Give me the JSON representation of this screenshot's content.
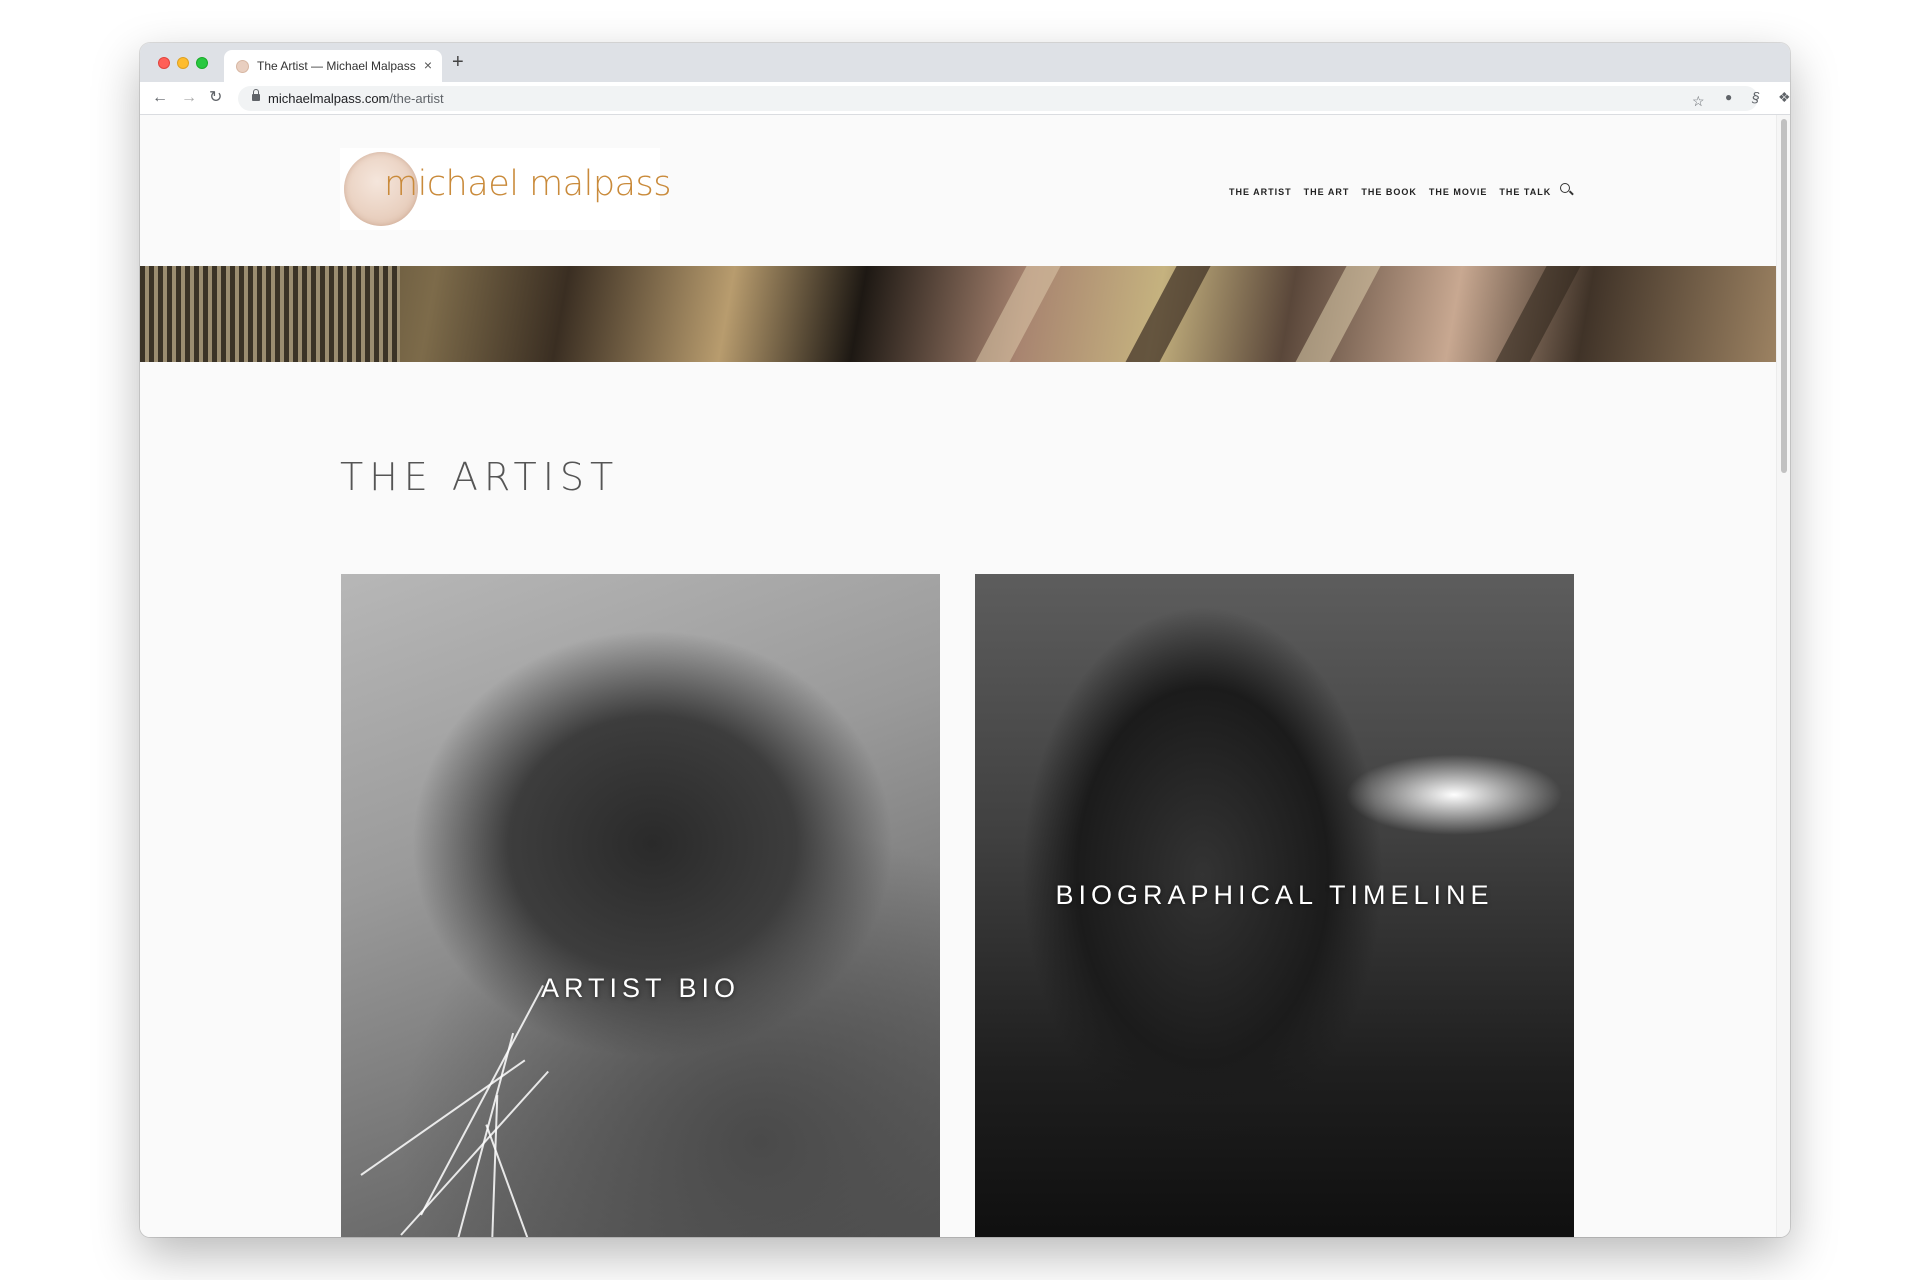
{
  "browser": {
    "tab_title": "The Artist — Michael Malpass",
    "tab_close": "×",
    "new_tab": "+",
    "url_domain": "michaelmalpass.com",
    "url_path": "/the-artist"
  },
  "site": {
    "logo_text": "michael malpass",
    "nav": [
      "THE ARTIST",
      "THE ART",
      "THE BOOK",
      "THE MOVIE",
      "THE TALK"
    ]
  },
  "main": {
    "title": "THE ARTIST",
    "cards": [
      {
        "label": "ARTIST BIO"
      },
      {
        "label": "BIOGRAPHICAL TIMELINE"
      }
    ]
  }
}
